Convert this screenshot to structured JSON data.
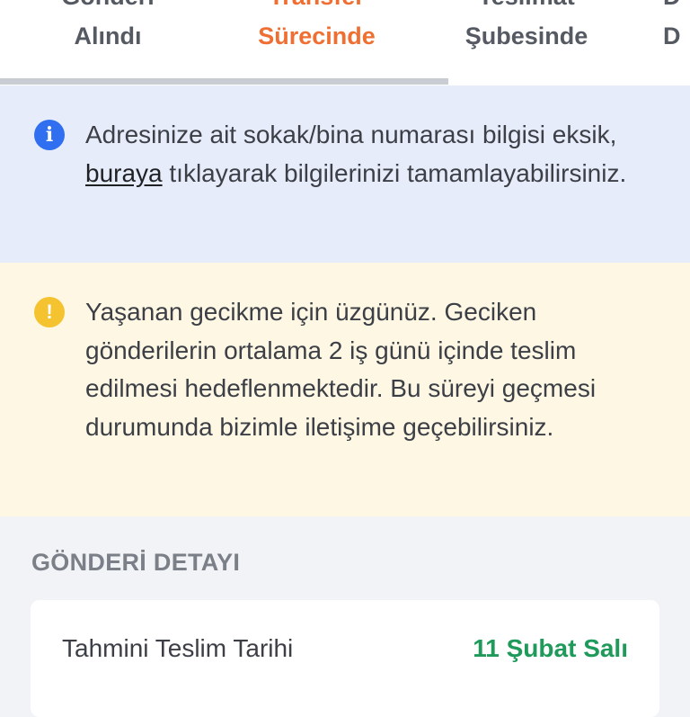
{
  "tabs": [
    {
      "line1": "Gönderi",
      "line2": "Alındı",
      "active": false
    },
    {
      "line1": "Transfer",
      "line2": "Sürecinde",
      "active": true
    },
    {
      "line1": "Teslimat",
      "line2": "Şubesinde",
      "active": false
    },
    {
      "line1": "D",
      "line2": "D",
      "active": false
    }
  ],
  "progress": {
    "fraction": 0.65
  },
  "info_banner": {
    "icon": "info-icon",
    "text_before": "Adresinize ait sokak/bina numarası bilgisi eksik, ",
    "link_text": "buraya",
    "text_after": " tıklayarak bilgilerinizi tamamlayabilirsiniz."
  },
  "warning_banner": {
    "icon": "warning-icon",
    "text": "Yaşanan gecikme için üzgünüz. Geciken gönderilerin ortalama 2 iş günü içinde teslim edilmesi hedeflenmektedir. Bu süreyi geçmesi durumunda bizimle iletişime geçebilirsiniz."
  },
  "details": {
    "section_title": "GÖNDERİ DETAYI",
    "estimated_delivery_label": "Tahmini Teslim Tarihi",
    "estimated_delivery_value": "11 Şubat Salı"
  },
  "colors": {
    "accent": "#ef6f33",
    "info": "#2f6ff0",
    "warning": "#f5c230",
    "success": "#1f9a5b"
  }
}
